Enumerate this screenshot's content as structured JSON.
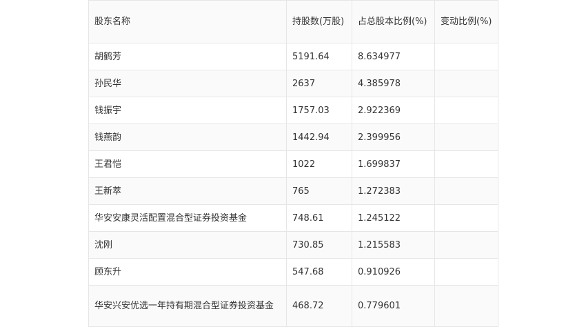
{
  "table": {
    "headers": [
      "股东名称",
      "持股数(万股)",
      "占总股本比例(%)",
      "变动比例(%)"
    ],
    "rows": [
      [
        "胡鹤芳",
        "5191.64",
        "8.634977",
        ""
      ],
      [
        "孙民华",
        "2637",
        "4.385978",
        ""
      ],
      [
        "钱振宇",
        "1757.03",
        "2.922369",
        ""
      ],
      [
        "钱燕韵",
        "1442.94",
        "2.399956",
        ""
      ],
      [
        "王君恺",
        "1022",
        "1.699837",
        ""
      ],
      [
        "王新萃",
        "765",
        "1.272383",
        ""
      ],
      [
        "华安安康灵活配置混合型证券投资基金",
        "748.61",
        "1.245122",
        ""
      ],
      [
        "沈刚",
        "730.85",
        "1.215583",
        ""
      ],
      [
        "顾东升",
        "547.68",
        "0.910926",
        ""
      ],
      [
        "华安兴安优选一年持有期混合型证券投资基金",
        "468.72",
        "0.779601",
        ""
      ]
    ]
  }
}
